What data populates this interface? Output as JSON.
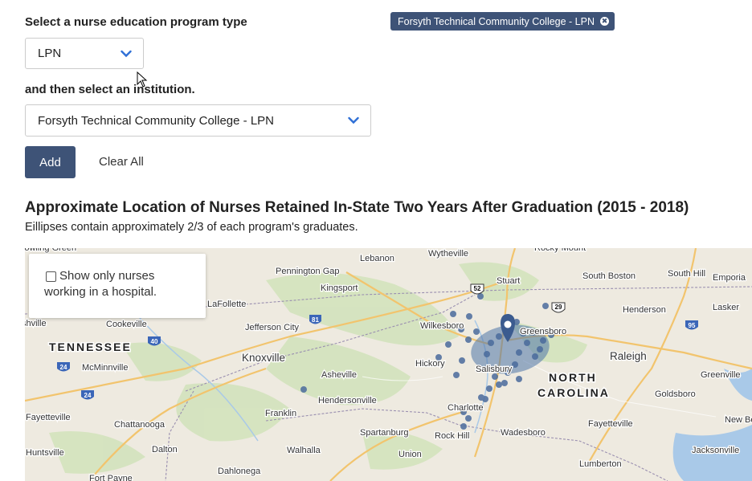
{
  "form": {
    "program_label": "Select a nurse education program type",
    "program_value": "LPN",
    "institution_label": "and then select an institution.",
    "institution_value": "Forsyth Technical Community College - LPN",
    "add_label": "Add",
    "clear_label": "Clear All"
  },
  "selected_tags": [
    {
      "label": "Forsyth Technical Community College - LPN",
      "remove": "✖"
    }
  ],
  "map_section": {
    "title": "Approximate Location of Nurses Retained In-State Two Years After Graduation (2015 - 2018)",
    "subtitle": "Eillipses contain approximately 2/3 of each program's graduates."
  },
  "map_overlay": {
    "checkbox_label": "Show only nurses working in a hospital.",
    "checked": false
  },
  "map": {
    "states": [
      "TENNESSEE",
      "NORTH",
      "CAROLINA"
    ],
    "places": [
      "Pennington Gap",
      "Lebanon",
      "Wytheville",
      "Rocky Mount",
      "Kingsport",
      "Stuart",
      "South Boston",
      "South Hill",
      "Emporia",
      "shville",
      "LaFollette",
      "Cookeville",
      "Jefferson City",
      "Wilkesboro",
      "Greensboro",
      "Henderson",
      "Lasker",
      "Knoxville",
      "Raleigh",
      "Hickory",
      "Salisbury",
      "McMinnville",
      "Asheville",
      "Charlotte",
      "Fayetteville",
      "Greenville",
      "Hendersonville",
      "Goldsboro",
      "Fayetteville",
      "Chattanooga",
      "Franklin",
      "Spartanburg",
      "Rock Hill",
      "Wadesboro",
      "New Be",
      "Huntsville",
      "Dalton",
      "Walhalla",
      "Union",
      "Lumberton",
      "Jacksonville",
      "Dahlonega",
      "Fort Payne",
      "Bowling Green"
    ],
    "shields": [
      "52",
      "29",
      "81",
      "40",
      "95",
      "24",
      "24"
    ],
    "colors": {
      "land": "#eeeae0",
      "forest": "#cfe0b8",
      "water": "#a9c9e8",
      "road": "#f2c46d",
      "dot": "#4a6b9c",
      "ellipse": "#4f74a8",
      "marker": "#3b5b8f"
    }
  }
}
